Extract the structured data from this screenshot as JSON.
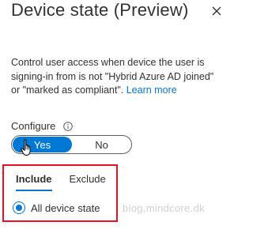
{
  "panel": {
    "title": "Device state (Preview)",
    "close_icon": "close-icon",
    "description_text": "Control user access when device the user is signing-in from is not \"Hybrid Azure AD joined\" or \"marked as compliant\". ",
    "learn_more_label": "Learn more"
  },
  "configure": {
    "label": "Configure",
    "info_icon": "info-icon",
    "options": [
      "Yes",
      "No"
    ],
    "selected": "Yes"
  },
  "tabs": {
    "include_label": "Include",
    "exclude_label": "Exclude",
    "active": "Include"
  },
  "include": {
    "radio_label": "All device state",
    "selected": true
  },
  "watermark": {
    "text": "blog.mindcore.dk"
  },
  "colors": {
    "accent": "#0078d4",
    "highlight_box": "#e81123",
    "text": "#323130"
  }
}
